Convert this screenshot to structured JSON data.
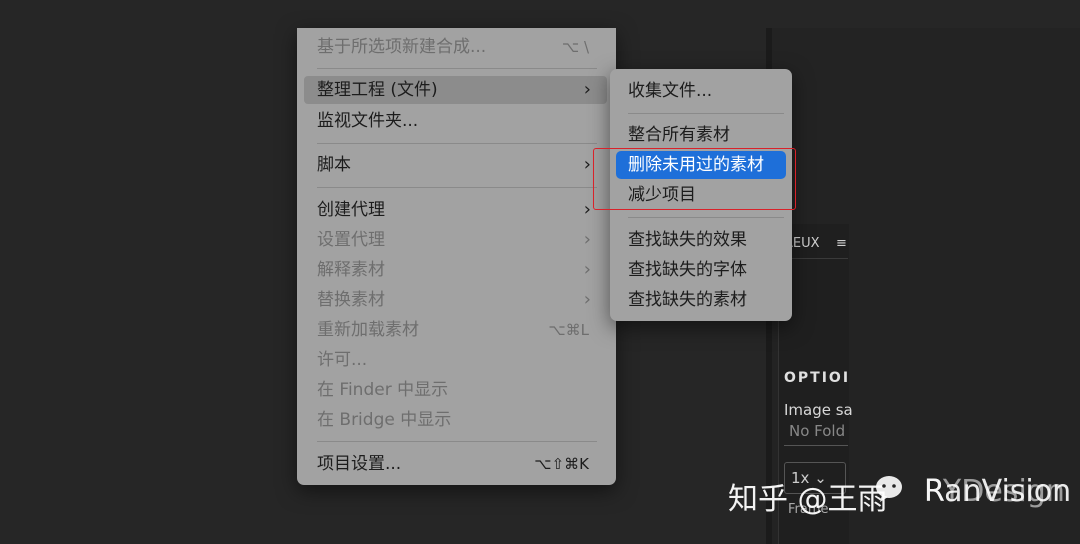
{
  "background_panel": {
    "aeux_title": "AEUX",
    "aeux_menu_icon": "hamburger-icon",
    "options_title": "OPTIOI",
    "image_label": "Image sa",
    "folder_value": "No Fold",
    "scale_value": "1x ⌄",
    "frame_label": "Frame"
  },
  "menu": {
    "items": [
      {
        "label": "基于所选项新建合成...",
        "shortcut": "⌥ \\",
        "disabled": true
      },
      {
        "label": "整理工程 (文件)",
        "chevron": "›",
        "highlighted": true
      },
      {
        "label": "监视文件夹..."
      },
      {
        "label": "脚本",
        "chevron": "›"
      },
      {
        "label": "创建代理",
        "chevron": "›"
      },
      {
        "label": "设置代理",
        "chevron": "›",
        "disabled": true
      },
      {
        "label": "解释素材",
        "chevron": "›",
        "disabled": true
      },
      {
        "label": "替换素材",
        "chevron": "›",
        "disabled": true
      },
      {
        "label": "重新加载素材",
        "shortcut": "⌥⌘L",
        "disabled": true
      },
      {
        "label": "许可...",
        "disabled": true
      },
      {
        "label": "在 Finder 中显示",
        "disabled": true
      },
      {
        "label": "在 Bridge 中显示",
        "disabled": true
      },
      {
        "label": "项目设置...",
        "shortcut": "⌥⇧⌘K"
      }
    ]
  },
  "submenu": {
    "items": [
      {
        "label": "收集文件..."
      },
      {
        "label": "整合所有素材"
      },
      {
        "label": "删除未用过的素材",
        "selected": true
      },
      {
        "label": "减少项目"
      },
      {
        "label": "查找缺失的效果"
      },
      {
        "label": "查找缺失的字体"
      },
      {
        "label": "查找缺失的素材"
      }
    ]
  },
  "annotation": {
    "color": "#d9222a"
  },
  "watermark": {
    "text": "知乎 @王雨",
    "brand": "RanVision",
    "overlay_brand": "RYDesign",
    "icon": "wechat-bubble-icon"
  },
  "colors": {
    "selection": "#1e6fd9",
    "menu_bg": "#a2a2a2"
  }
}
